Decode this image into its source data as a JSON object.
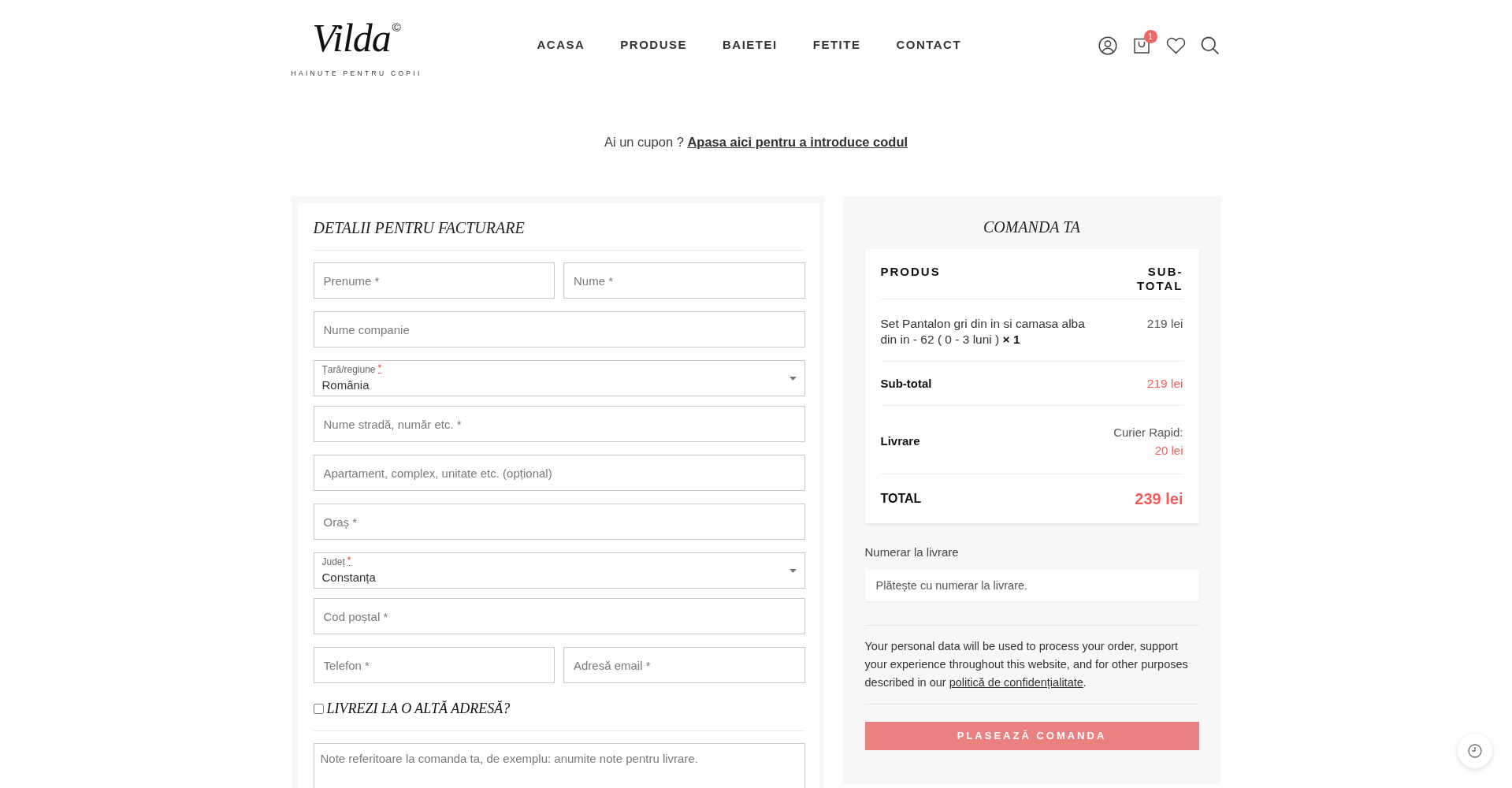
{
  "header": {
    "logo": {
      "wordmark": "Vilda",
      "mark": "©",
      "tagline": "HAINUTE PENTRU COPII"
    },
    "nav": [
      {
        "label": "ACASA"
      },
      {
        "label": "PRODUSE"
      },
      {
        "label": "BAIETEI"
      },
      {
        "label": "FETITE"
      },
      {
        "label": "CONTACT"
      }
    ],
    "cart_count": "1"
  },
  "coupon": {
    "prompt": "Ai un cupon ?",
    "link": "Apasa aici pentru a introduce codul"
  },
  "billing": {
    "title": "DETALII PENTRU FACTURARE",
    "rows": [
      [
        {
          "kind": "input",
          "placeholder": "Prenume *"
        },
        {
          "kind": "input",
          "placeholder": "Nume *"
        }
      ],
      [
        {
          "kind": "input",
          "placeholder": "Nume companie"
        }
      ],
      [
        {
          "kind": "select",
          "label": "Țară/regiune",
          "required_mark": "*",
          "value": "România"
        }
      ],
      [
        {
          "kind": "input",
          "placeholder": "Nume stradă, număr etc. *"
        }
      ],
      [
        {
          "kind": "input",
          "placeholder": "Apartament, complex, unitate etc. (opțional)"
        }
      ],
      [
        {
          "kind": "input",
          "placeholder": "Oraș *"
        }
      ],
      [
        {
          "kind": "select",
          "label": "Județ",
          "required_mark": "*",
          "value": "Constanța"
        }
      ],
      [
        {
          "kind": "input",
          "placeholder": "Cod poștal *"
        }
      ],
      [
        {
          "kind": "input",
          "placeholder": "Telefon *"
        },
        {
          "kind": "input",
          "placeholder": "Adresă email *"
        }
      ]
    ],
    "ship_elsewhere": {
      "label": "LIVREZI LA O ALTĂ ADRESĂ?",
      "checked": false
    },
    "notes": {
      "placeholder": "Note referitoare la comanda ta, de exemplu: anumite note pentru livrare."
    }
  },
  "order": {
    "title": "COMANDA TA",
    "columns": [
      "PRODUS",
      "SUB-TOTAL"
    ],
    "items": [
      {
        "description": "Set Pantalon gri din in si camasa alba din in - 62 ( 0 - 3 luni )  **× 1**",
        "subtotal": "219 lei"
      }
    ],
    "subtotal": {
      "label": "Sub-total",
      "value": "219 lei"
    },
    "shipping": {
      "label": "Livrare",
      "method": "Curier Rapid:",
      "price": "20 lei"
    },
    "total": {
      "label": "TOTAL",
      "value": "239 lei"
    }
  },
  "payment": {
    "method": "Numerar la livrare",
    "description": "Plătește cu numerar la livrare."
  },
  "privacy": {
    "text": "Your personal data will be used to process your order, support your experience throughout this website, and for other purposes described in our",
    "link": "politică de confidențialitate",
    "end": "."
  },
  "place_order": {
    "label": "PLASEAZĂ COMANDA",
    "disabled": true
  }
}
